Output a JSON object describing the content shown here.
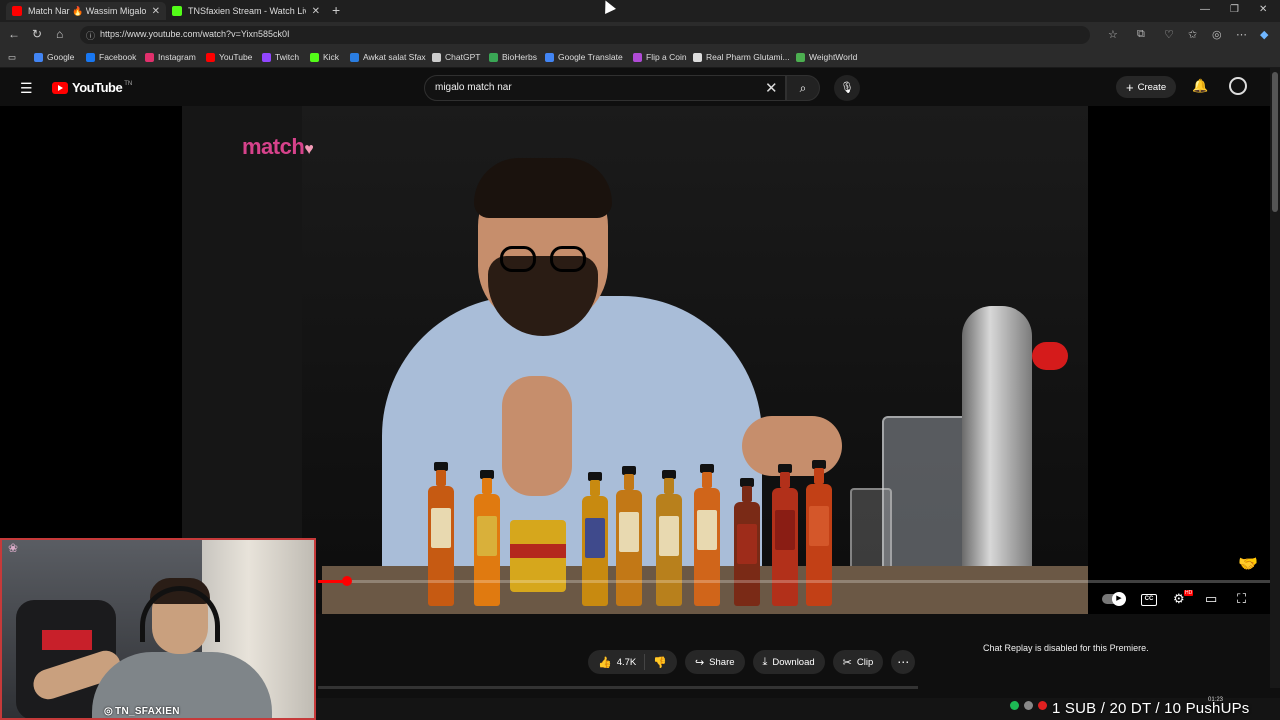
{
  "browser": {
    "tabs": [
      {
        "title": "Match Nar 🔥 Wassim Migalou -",
        "favicon_color": "#ff0000"
      },
      {
        "title": "TNSfaxien Stream - Watch Live o",
        "favicon_color": "#53fc18"
      }
    ],
    "new_tab": "+",
    "url": "https://www.youtube.com/watch?v=Yixn585ck0I",
    "bookmarks": [
      {
        "label": "Google",
        "color": "#4285f4"
      },
      {
        "label": "Facebook",
        "color": "#1877f2"
      },
      {
        "label": "Instagram",
        "color": "#e1306c"
      },
      {
        "label": "YouTube",
        "color": "#ff0000"
      },
      {
        "label": "Twitch",
        "color": "#9146ff"
      },
      {
        "label": "Kick",
        "color": "#53fc18"
      },
      {
        "label": "Awkat salat Sfax",
        "color": "#2a7de1"
      },
      {
        "label": "ChatGPT",
        "color": "#cccccc"
      },
      {
        "label": "BioHerbs",
        "color": "#3aa655"
      },
      {
        "label": "Google Translate",
        "color": "#4285f4"
      },
      {
        "label": "Flip a Coin",
        "color": "#b04bd6"
      },
      {
        "label": "Real Pharm Glutami...",
        "color": "#dddddd"
      },
      {
        "label": "WeightWorld",
        "color": "#4caf50"
      }
    ]
  },
  "youtube": {
    "brand": "YouTube",
    "country_code": "TN",
    "search_query": "migalo match nar",
    "create_label": "Create"
  },
  "video": {
    "overlay_logo": "match",
    "progress_fraction": 0.03
  },
  "actions": {
    "likes": "4.7K",
    "share": "Share",
    "download": "Download",
    "clip": "Clip"
  },
  "chat": {
    "replay_message": "Chat Replay is disabled for this Premiere."
  },
  "stream_overlay": {
    "handle": "TN_SFAXIEN",
    "ticker": "1 SUB / 20 DT / 10 PushUPs",
    "clock": "01:23"
  },
  "colors": {
    "accent": "#ff0000",
    "match_brand": "#d6428b"
  }
}
